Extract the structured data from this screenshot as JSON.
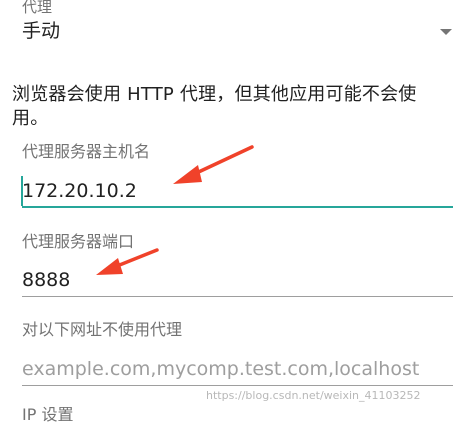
{
  "proxy": {
    "label": "代理",
    "value": "手动"
  },
  "info_text": "浏览器会使用 HTTP 代理，但其他应用可能不会使用。",
  "hostname": {
    "label": "代理服务器主机名",
    "value": "172.20.10.2"
  },
  "port": {
    "label": "代理服务器端口",
    "value": "8888"
  },
  "bypass": {
    "label": "对以下网址不使用代理",
    "placeholder": "example.com,mycomp.test.com,localhost"
  },
  "ip_settings": {
    "label": "IP 设置"
  },
  "watermark": "https://blog.csdn.net/weixin_41103252",
  "colors": {
    "accent": "#26a69a",
    "arrow": "#f0422a",
    "label": "#737373",
    "text": "#212121"
  }
}
